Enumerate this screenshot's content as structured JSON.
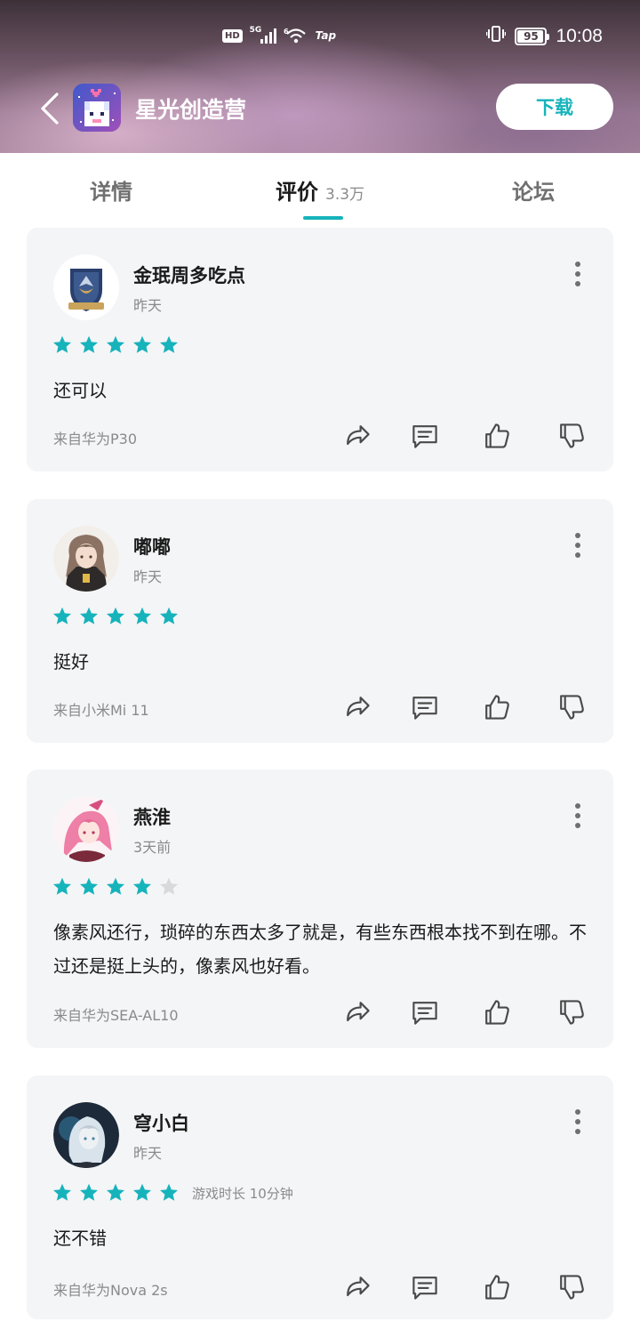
{
  "status_bar": {
    "hd": "HD",
    "signal_label": "5G",
    "wifi_label": "6",
    "tap_label": "Tap",
    "battery": "95",
    "time": "10:08"
  },
  "app_bar": {
    "title": "星光创造营",
    "download_label": "下载"
  },
  "tabs": [
    {
      "label": "详情"
    },
    {
      "label": "评价",
      "count": "3.3万"
    },
    {
      "label": "论坛"
    }
  ],
  "reviews": [
    {
      "user": "金珉周多吃点",
      "time": "昨天",
      "rating": 5,
      "content": "还可以",
      "device": "来自华为P30"
    },
    {
      "user": "嘟嘟",
      "time": "昨天",
      "rating": 5,
      "content": "挺好",
      "device": "来自小米Mi 11"
    },
    {
      "user": "燕淮",
      "time": "3天前",
      "rating": 4,
      "content": "像素风还行，琐碎的东西太多了就是，有些东西根本找不到在哪。不过还是挺上头的，像素风也好看。",
      "device": "来自华为SEA-AL10"
    },
    {
      "user": "穹小白",
      "time": "昨天",
      "rating": 5,
      "playtime": "游戏时长 10分钟",
      "content": "还不错",
      "device": "来自华为Nova 2s"
    }
  ],
  "colors": {
    "accent": "#16b3bb",
    "star_filled": "#16b3bb",
    "star_empty": "#d9d9d9",
    "card_bg": "#f4f5f7"
  }
}
